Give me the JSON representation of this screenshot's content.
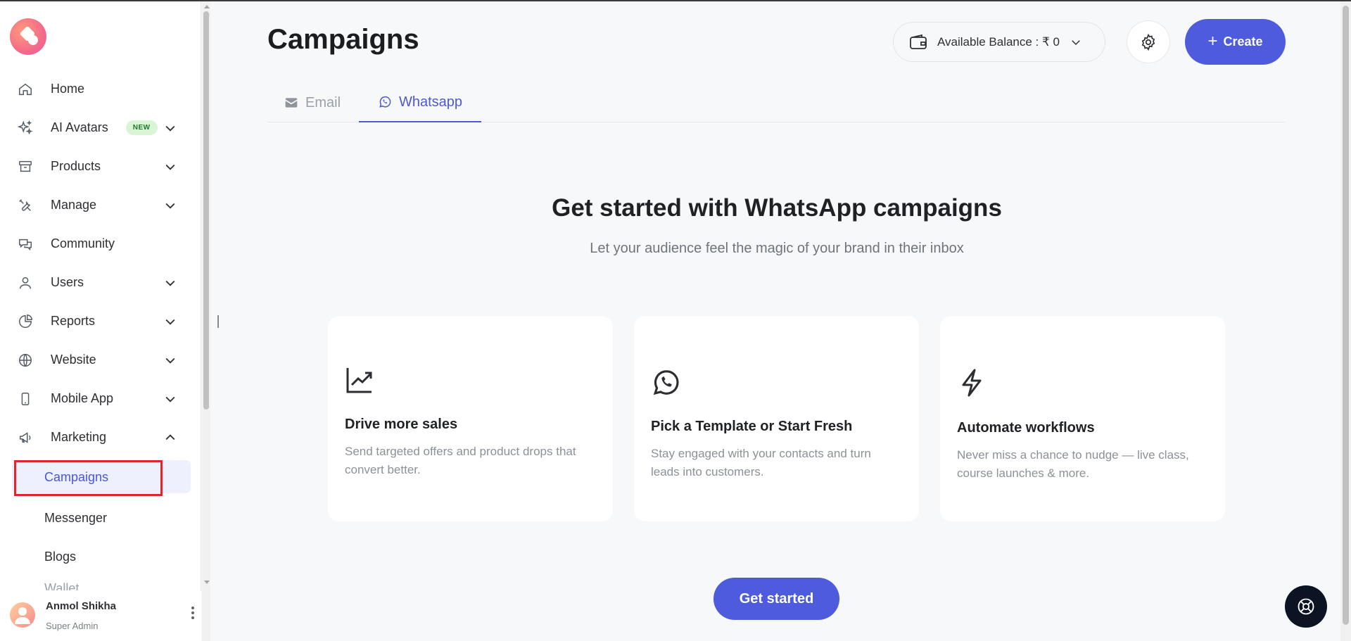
{
  "sidebar": {
    "items": [
      {
        "label": "Home",
        "icon": "home-icon"
      },
      {
        "label": "AI Avatars",
        "icon": "sparkles-icon",
        "badge": "NEW"
      },
      {
        "label": "Products",
        "icon": "archive-icon"
      },
      {
        "label": "Manage",
        "icon": "tools-icon"
      },
      {
        "label": "Community",
        "icon": "chat-bubbles-icon"
      },
      {
        "label": "Users",
        "icon": "user-icon"
      },
      {
        "label": "Reports",
        "icon": "pie-chart-icon"
      },
      {
        "label": "Website",
        "icon": "globe-icon"
      },
      {
        "label": "Mobile App",
        "icon": "smartphone-icon"
      },
      {
        "label": "Marketing",
        "icon": "megaphone-icon"
      }
    ],
    "sub_items": [
      {
        "label": "Campaigns",
        "active": true
      },
      {
        "label": "Messenger"
      },
      {
        "label": "Blogs"
      },
      {
        "label": "Wallet"
      }
    ],
    "user": {
      "name": "Anmol Shikha",
      "role": "Super Admin"
    }
  },
  "header": {
    "title": "Campaigns",
    "balance_label": "Available Balance : ₹ 0",
    "create_label": "Create"
  },
  "tabs": [
    {
      "label": "Email",
      "icon": "mail-icon",
      "active": false
    },
    {
      "label": "Whatsapp",
      "icon": "whatsapp-icon",
      "active": true
    }
  ],
  "hero": {
    "title": "Get started with WhatsApp campaigns",
    "subtitle": "Let your audience feel the magic of your brand in their inbox"
  },
  "cards": [
    {
      "icon": "trending-up-icon",
      "title": "Drive more sales",
      "desc": "Send targeted offers and product drops that convert better."
    },
    {
      "icon": "whatsapp-icon",
      "title": "Pick a Template or Start Fresh",
      "desc": "Stay engaged with your contacts and turn leads into customers."
    },
    {
      "icon": "lightning-icon",
      "title": "Automate workflows",
      "desc": "Never miss a chance to nudge — live class, course launches & more."
    }
  ],
  "cta": {
    "label": "Get started"
  },
  "colors": {
    "accent": "#4d5bdc",
    "highlight_box": "#e0262b"
  }
}
